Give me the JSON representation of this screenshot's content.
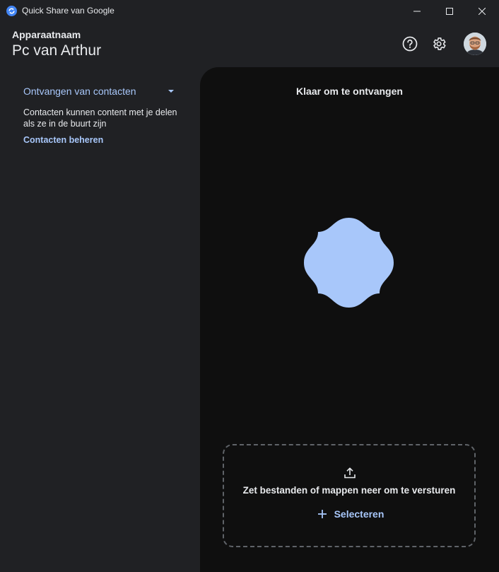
{
  "window": {
    "title": "Quick Share van Google"
  },
  "header": {
    "device_label": "Apparaatnaam",
    "device_name": "Pc van Arthur"
  },
  "left_panel": {
    "receive_mode": "Ontvangen van contacten",
    "description": "Contacten kunnen content met je delen als ze in de buurt zijn",
    "manage_link": "Contacten beheren"
  },
  "right_panel": {
    "status": "Klaar om te ontvangen",
    "dropzone_text": "Zet bestanden of mappen neer om te versturen",
    "select_label": "Selecteren"
  },
  "colors": {
    "accent": "#a8c7fa",
    "blob": "#a8c7fa",
    "background": "#202124",
    "panel": "#0f0f0f"
  },
  "icons": {
    "app": "quick-share-icon",
    "help": "help-circle-icon",
    "settings": "gear-icon",
    "dropdown": "caret-down-icon",
    "upload": "upload-icon",
    "add": "plus-icon"
  }
}
